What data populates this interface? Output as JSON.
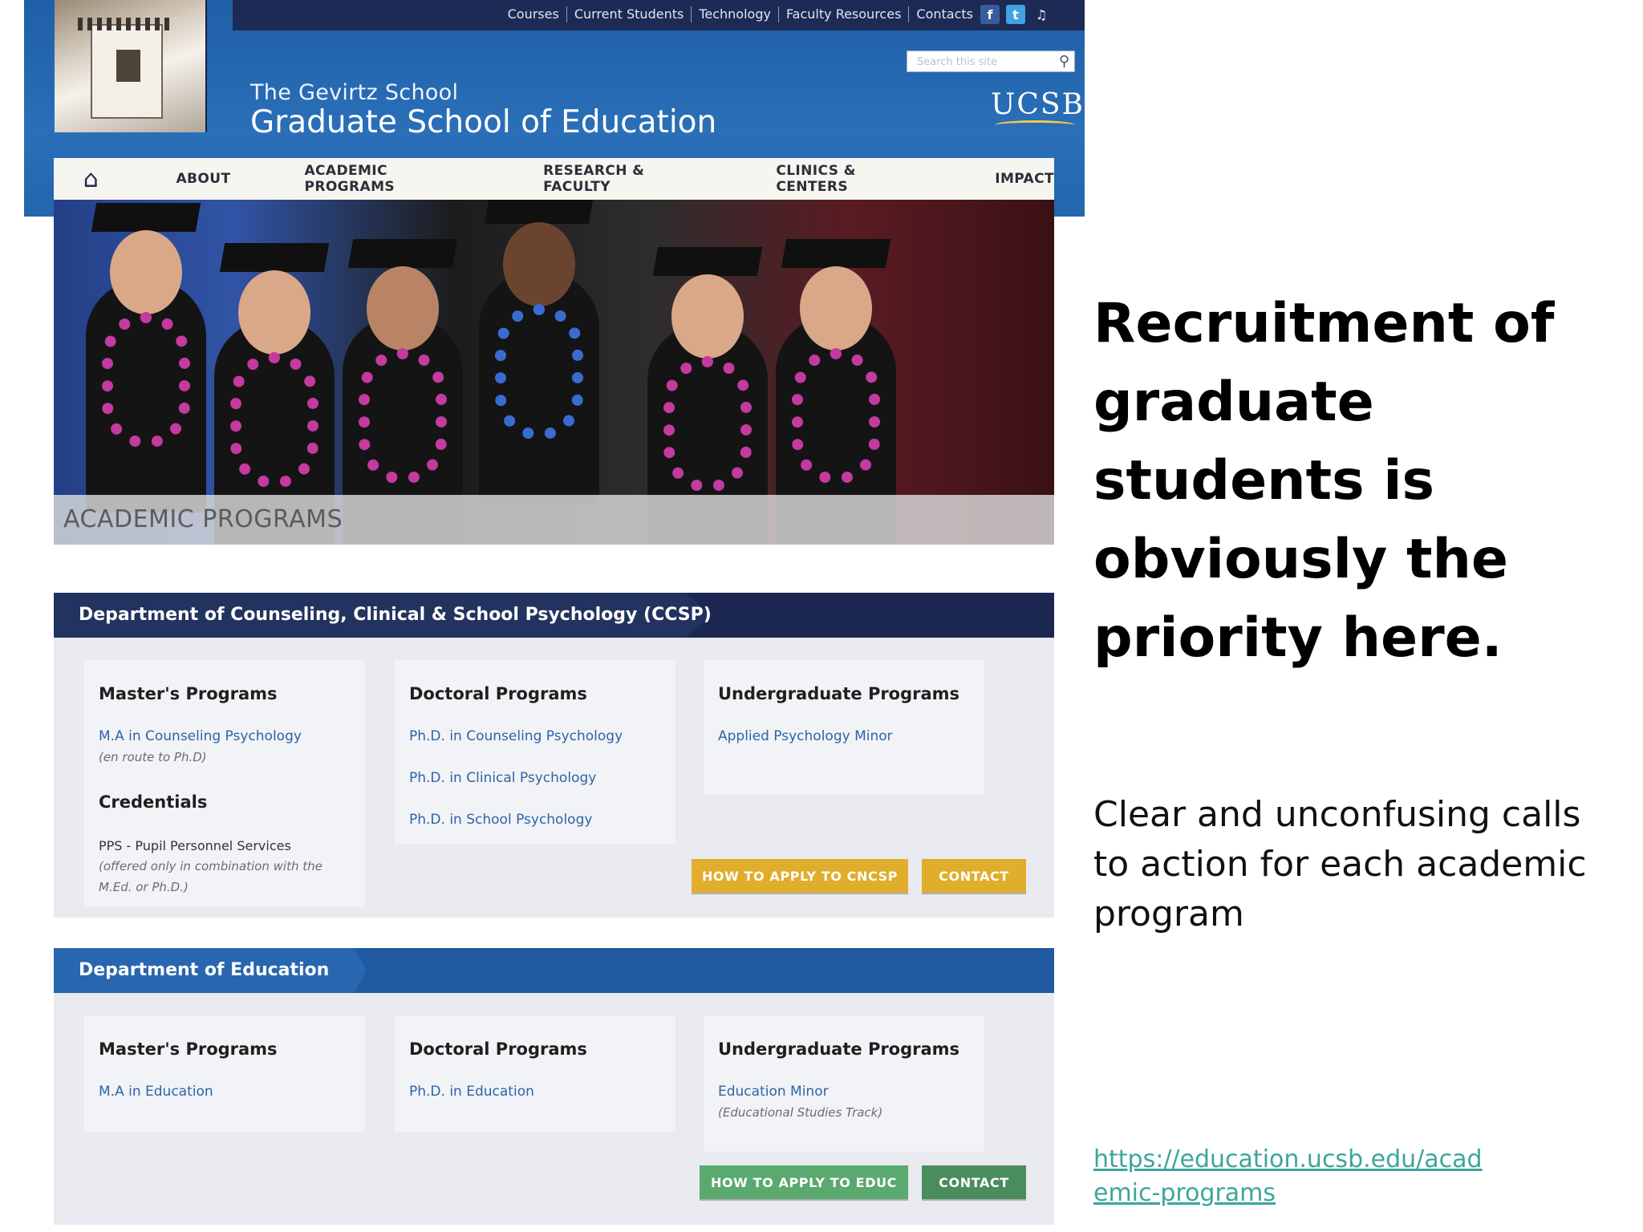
{
  "site": {
    "top_links": [
      "Courses",
      "Current Students",
      "Technology",
      "Faculty Resources",
      "Contacts"
    ],
    "social": [
      "f",
      "t",
      "♫"
    ],
    "search_placeholder": "Search this site",
    "school_sub": "The Gevirtz School",
    "school_main": "Graduate School of Education",
    "ucsb": "UCSB",
    "nav": [
      "ABOUT",
      "ACADEMIC PROGRAMS",
      "RESEARCH & FACULTY",
      "CLINICS & CENTERS",
      "IMPACT"
    ],
    "hero_label": "ACADEMIC PROGRAMS"
  },
  "dept1": {
    "title": "Department of Counseling, Clinical & School Psychology (CCSP)",
    "masters_title": "Master's Programs",
    "masters_link": "M.A in Counseling Psychology",
    "masters_note": "(en route to Ph.D)",
    "credentials_title": "Credentials",
    "credentials_item": "PPS - Pupil Personnel Services",
    "credentials_note_1": "(offered only in combination with the",
    "credentials_note_2": "M.Ed. or Ph.D.)",
    "doctoral_title": "Doctoral Programs",
    "doctoral_links": [
      "Ph.D. in Counseling Psychology",
      "Ph.D. in Clinical Psychology",
      "Ph.D. in School Psychology"
    ],
    "undergrad_title": "Undergraduate Programs",
    "undergrad_link": "Applied Psychology Minor",
    "apply_button": "HOW TO APPLY TO CNCSP",
    "contact_button": "CONTACT"
  },
  "dept2": {
    "title": "Department of Education",
    "masters_title": "Master's Programs",
    "masters_link": "M.A in Education",
    "doctoral_title": "Doctoral Programs",
    "doctoral_link": "Ph.D. in Education",
    "undergrad_title": "Undergraduate Programs",
    "undergrad_link": "Education Minor",
    "undergrad_note": "(Educational Studies Track)",
    "apply_button": "HOW TO APPLY TO EDUC",
    "contact_button": "CONTACT"
  },
  "slide": {
    "headline": "Recruitment of graduate students is obviously the priority here.",
    "body": "Clear and unconfusing calls to action for each academic program",
    "url": "https://education.ucsb.edu/academic-programs"
  },
  "colors": {
    "header_blue": "#1f5fa6",
    "dept1_bar": "#1b2750",
    "dept2_bar": "#1f5aa1",
    "gold_button": "#e0ad2c",
    "green_button": "#5aa96f",
    "link_blue": "#2d63a8",
    "url_teal": "#3ea59a"
  }
}
